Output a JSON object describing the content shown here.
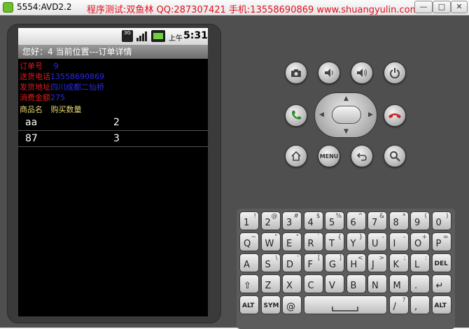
{
  "window": {
    "title": "5554:AVD2.2",
    "watermark": "程序测试:双鱼林 QQ:287307421 手机:13558690869 www.shuangyulin.com",
    "minimize_glyph": "—",
    "maximize_glyph": "□",
    "close_glyph": "✕"
  },
  "statusbar": {
    "network": "3G",
    "time_period": "上午",
    "time": "5:31"
  },
  "appbar": {
    "greeting": "您好：4   当前位置---订单详情"
  },
  "order": {
    "order_no_label": "订单号",
    "order_no_value": "9",
    "phone_label": "送货电话",
    "phone_value": "13558690869",
    "address_label": "发货地址",
    "address_value": "四川成都二仙桥",
    "amount_label": "消费金额",
    "amount_value": "275"
  },
  "items_header": {
    "name": "商品名",
    "qty": "购买数量"
  },
  "items": [
    {
      "name": "aa",
      "qty": "2"
    },
    {
      "name": "87",
      "qty": "3"
    }
  ],
  "hardware": {
    "menu_label": "MENU"
  },
  "keyboard": {
    "row1": [
      {
        "m": "1",
        "s": "!"
      },
      {
        "m": "2",
        "s": "@"
      },
      {
        "m": "3",
        "s": "#"
      },
      {
        "m": "4",
        "s": "$"
      },
      {
        "m": "5",
        "s": "%"
      },
      {
        "m": "6",
        "s": "^"
      },
      {
        "m": "7",
        "s": "&"
      },
      {
        "m": "8",
        "s": "*"
      },
      {
        "m": "9",
        "s": "("
      },
      {
        "m": "0",
        "s": ")"
      }
    ],
    "row2": [
      {
        "m": "Q",
        "s": "~"
      },
      {
        "m": "W",
        "s": "\""
      },
      {
        "m": "E",
        "s": "\""
      },
      {
        "m": "R",
        "s": "`"
      },
      {
        "m": "T",
        "s": "{"
      },
      {
        "m": "Y",
        "s": "}"
      },
      {
        "m": "U",
        "s": "-"
      },
      {
        "m": "I",
        "s": "-"
      },
      {
        "m": "O",
        "s": "+"
      },
      {
        "m": "P",
        "s": "="
      }
    ],
    "row3": [
      {
        "m": "A",
        "s": ""
      },
      {
        "m": "S",
        "s": "\\"
      },
      {
        "m": "D",
        "s": "'"
      },
      {
        "m": "F",
        "s": "["
      },
      {
        "m": "G",
        "s": "]"
      },
      {
        "m": "H",
        "s": "<"
      },
      {
        "m": "J",
        "s": ">"
      },
      {
        "m": "K",
        "s": ";"
      },
      {
        "m": "L",
        "s": ":"
      },
      {
        "m": "DEL",
        "s": ""
      }
    ],
    "row4": [
      {
        "m": "⇧",
        "s": ""
      },
      {
        "m": "Z",
        "s": ""
      },
      {
        "m": "X",
        "s": ""
      },
      {
        "m": "C",
        "s": ""
      },
      {
        "m": "V",
        "s": ""
      },
      {
        "m": "B",
        "s": ""
      },
      {
        "m": "N",
        "s": ""
      },
      {
        "m": "M",
        "s": ""
      },
      {
        "m": ".",
        "s": ""
      },
      {
        "m": "↵",
        "s": ""
      }
    ],
    "row5": {
      "alt": "ALT",
      "sym": "SYM",
      "at": "@",
      "slash_main": "/",
      "slash_sub": "?",
      "comma": ",",
      "alt2": "ALT"
    }
  }
}
